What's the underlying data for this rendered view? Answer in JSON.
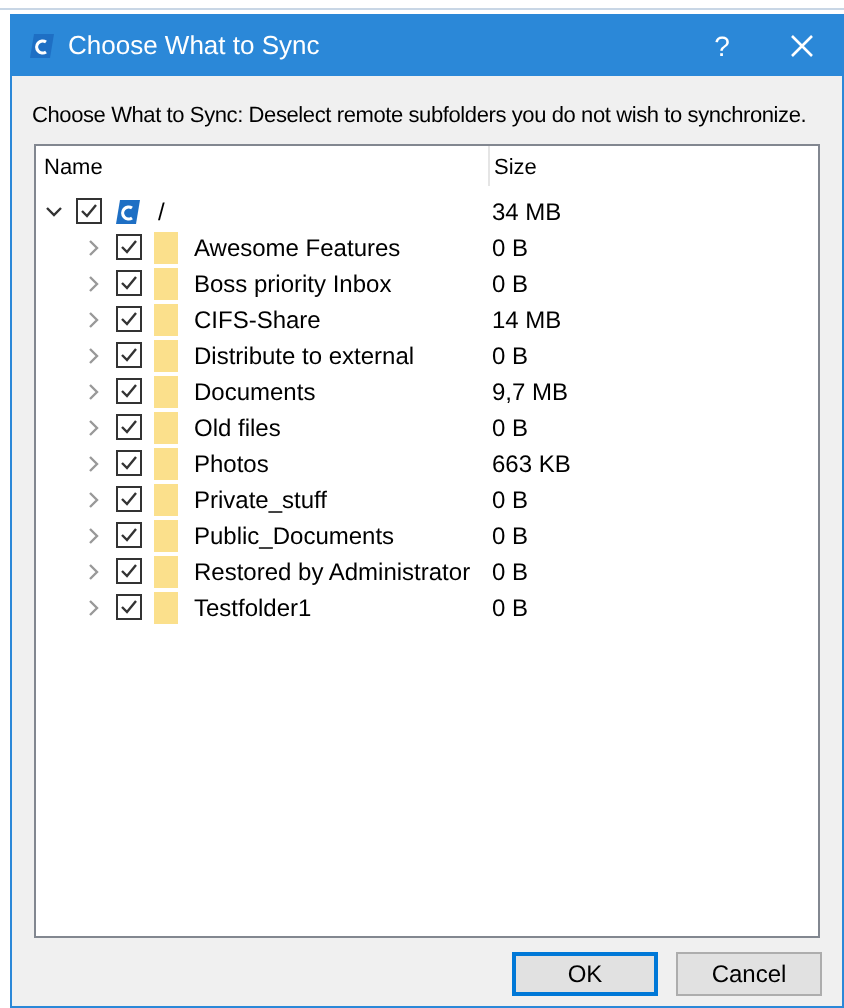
{
  "window": {
    "title": "Choose What to Sync",
    "help": "?"
  },
  "instruction": "Choose What to Sync: Deselect remote subfolders you do not wish to synchronize.",
  "tree": {
    "columns": [
      "Name",
      "Size"
    ],
    "items": [
      {
        "kind": "root",
        "name": "/",
        "size": "34 MB",
        "checked": true,
        "expanded": true,
        "children": [
          {
            "kind": "folder",
            "name": "Awesome Features",
            "size": "0 B",
            "checked": true,
            "expanded": false
          },
          {
            "kind": "folder",
            "name": "Boss priority Inbox",
            "size": "0 B",
            "checked": true,
            "expanded": false
          },
          {
            "kind": "folder",
            "name": "CIFS-Share",
            "size": "14 MB",
            "checked": true,
            "expanded": false
          },
          {
            "kind": "folder",
            "name": "Distribute to external",
            "size": "0 B",
            "checked": true,
            "expanded": false
          },
          {
            "kind": "folder",
            "name": "Documents",
            "size": "9,7 MB",
            "checked": true,
            "expanded": false
          },
          {
            "kind": "folder",
            "name": "Old files",
            "size": "0 B",
            "checked": true,
            "expanded": false
          },
          {
            "kind": "folder",
            "name": "Photos",
            "size": "663 KB",
            "checked": true,
            "expanded": false
          },
          {
            "kind": "folder",
            "name": "Private_stuff",
            "size": "0 B",
            "checked": true,
            "expanded": false
          },
          {
            "kind": "folder",
            "name": "Public_Documents",
            "size": "0 B",
            "checked": true,
            "expanded": false
          },
          {
            "kind": "folder",
            "name": "Restored by Administrator",
            "size": "0 B",
            "checked": true,
            "expanded": false
          },
          {
            "kind": "folder",
            "name": "Testfolder1",
            "size": "0 B",
            "checked": true,
            "expanded": false
          }
        ]
      }
    ]
  },
  "buttons": [
    {
      "label": "OK",
      "default": true
    },
    {
      "label": "Cancel",
      "default": false
    }
  ]
}
